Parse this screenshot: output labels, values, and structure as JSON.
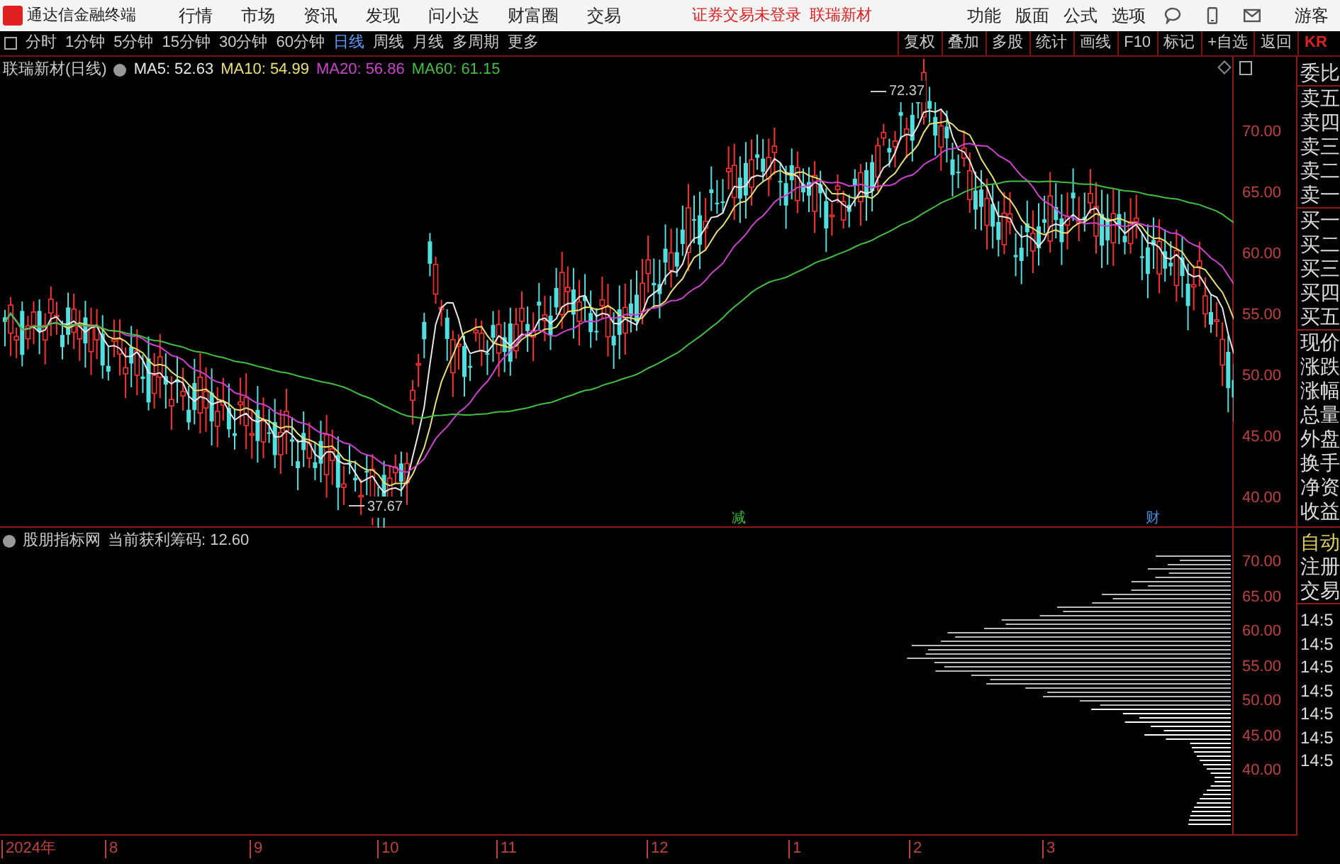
{
  "app_title": "通达信金融终端",
  "menu": [
    "行情",
    "市场",
    "资讯",
    "发现",
    "问小达",
    "财富圈",
    "交易"
  ],
  "notice": "证券交易未登录",
  "stock_link": "联瑞新材",
  "right_menu": [
    "功能",
    "版面",
    "公式",
    "选项"
  ],
  "user": "游客",
  "period_tabs": [
    {
      "label": "分时",
      "selected": false
    },
    {
      "label": "1分钟",
      "selected": false
    },
    {
      "label": "5分钟",
      "selected": false
    },
    {
      "label": "15分钟",
      "selected": false
    },
    {
      "label": "30分钟",
      "selected": false
    },
    {
      "label": "60分钟",
      "selected": false
    },
    {
      "label": "日线",
      "selected": true
    },
    {
      "label": "周线",
      "selected": false
    },
    {
      "label": "月线",
      "selected": false
    },
    {
      "label": "多周期",
      "selected": false
    },
    {
      "label": "更多",
      "selected": false
    }
  ],
  "toolbar_buttons": [
    "复权",
    "叠加",
    "多股",
    "统计",
    "画线",
    "F10",
    "标记",
    "+自选",
    "返回"
  ],
  "corner_code": "KR",
  "main_chart": {
    "title": "联瑞新材(日线)",
    "ma": [
      {
        "label": "MA5: 52.63",
        "color": "#e8e8e8"
      },
      {
        "label": "MA10: 54.99",
        "color": "#e8e070"
      },
      {
        "label": "MA20: 56.86",
        "color": "#d040d0"
      },
      {
        "label": "MA60: 61.15",
        "color": "#40c040"
      }
    ],
    "price_labels": [
      "70.00",
      "65.00",
      "60.00",
      "55.00",
      "50.00",
      "45.00",
      "40.00"
    ],
    "high_label": "72.37",
    "low_label": "37.67",
    "markers": [
      {
        "text": "减",
        "color": "#30c030"
      },
      {
        "text": "财",
        "color": "#4090e0"
      }
    ]
  },
  "indicator": {
    "title": "股朋指标网",
    "reading": "当前获利筹码: 12.60",
    "price_labels": [
      "70.00",
      "65.00",
      "60.00",
      "55.00",
      "50.00",
      "45.00",
      "40.00"
    ]
  },
  "side_panel": {
    "quote_rows": [
      "委比",
      "卖五",
      "卖四",
      "卖三",
      "卖二",
      "卖一",
      "买一",
      "买二",
      "买三",
      "买四",
      "买五",
      "现价",
      "涨跌",
      "涨幅",
      "总量",
      "外盘",
      "换手",
      "净资",
      "收益"
    ],
    "info_rows": [
      "自动",
      "注册",
      "交易"
    ],
    "times": [
      "14:5",
      "14:5",
      "14:5",
      "14:5",
      "14:5",
      "14:5",
      "14:5"
    ]
  },
  "date_axis": [
    "2024年",
    "8",
    "9",
    "10",
    "11",
    "12",
    "1",
    "2",
    "3"
  ]
}
